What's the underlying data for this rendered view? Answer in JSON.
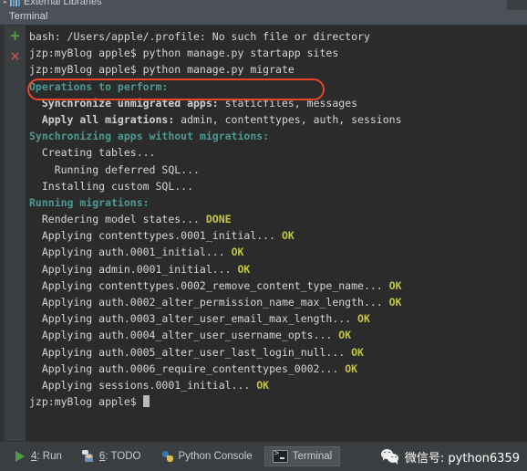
{
  "window": {
    "project_tree_row_label": "External Libraries",
    "tool_window_tab": "Terminal"
  },
  "gutter": {
    "add_icon": "+",
    "close_icon": "×"
  },
  "terminal": {
    "prompt": "jzp:myBlog apple$",
    "cursor": " ",
    "lines": [
      {
        "id": "l01",
        "segments": [
          {
            "text": "bash: /Users/apple/.profile: No such file or directory",
            "style": "default"
          }
        ]
      },
      {
        "id": "l02",
        "segments": [
          {
            "text": "jzp:myBlog apple$ python manage.py startapp sites",
            "style": "default"
          }
        ]
      },
      {
        "id": "l03",
        "segments": [
          {
            "text": "jzp:myBlog apple$ python manage.py migrate",
            "style": "default"
          }
        ],
        "highlighted": true
      },
      {
        "id": "l04",
        "segments": [
          {
            "text": "Operations to perform:",
            "style": "teal"
          }
        ]
      },
      {
        "id": "l05",
        "segments": [
          {
            "text": "  Synchronize unmigrated apps: ",
            "style": "bold"
          },
          {
            "text": "staticfiles, messages",
            "style": "default"
          }
        ]
      },
      {
        "id": "l06",
        "segments": [
          {
            "text": "  Apply all migrations: ",
            "style": "bold"
          },
          {
            "text": "admin, contenttypes, auth, sessions",
            "style": "default"
          }
        ]
      },
      {
        "id": "l07",
        "segments": [
          {
            "text": "Synchronizing apps without migrations:",
            "style": "teal"
          }
        ]
      },
      {
        "id": "l08",
        "segments": [
          {
            "text": "  Creating tables...",
            "style": "default"
          }
        ]
      },
      {
        "id": "l09",
        "segments": [
          {
            "text": "    Running deferred SQL...",
            "style": "default"
          }
        ]
      },
      {
        "id": "l10",
        "segments": [
          {
            "text": "  Installing custom SQL...",
            "style": "default"
          }
        ]
      },
      {
        "id": "l11",
        "segments": [
          {
            "text": "Running migrations:",
            "style": "teal"
          }
        ]
      },
      {
        "id": "l12",
        "segments": [
          {
            "text": "  Rendering model states... ",
            "style": "default"
          },
          {
            "text": "DONE",
            "style": "ok"
          }
        ]
      },
      {
        "id": "l13",
        "segments": [
          {
            "text": "  Applying contenttypes.0001_initial... ",
            "style": "default"
          },
          {
            "text": "OK",
            "style": "ok"
          }
        ]
      },
      {
        "id": "l14",
        "segments": [
          {
            "text": "  Applying auth.0001_initial... ",
            "style": "default"
          },
          {
            "text": "OK",
            "style": "ok"
          }
        ]
      },
      {
        "id": "l15",
        "segments": [
          {
            "text": "  Applying admin.0001_initial... ",
            "style": "default"
          },
          {
            "text": "OK",
            "style": "ok"
          }
        ]
      },
      {
        "id": "l16",
        "segments": [
          {
            "text": "  Applying contenttypes.0002_remove_content_type_name... ",
            "style": "default"
          },
          {
            "text": "OK",
            "style": "ok"
          }
        ]
      },
      {
        "id": "l17",
        "segments": [
          {
            "text": "  Applying auth.0002_alter_permission_name_max_length... ",
            "style": "default"
          },
          {
            "text": "OK",
            "style": "ok"
          }
        ]
      },
      {
        "id": "l18",
        "segments": [
          {
            "text": "  Applying auth.0003_alter_user_email_max_length... ",
            "style": "default"
          },
          {
            "text": "OK",
            "style": "ok"
          }
        ]
      },
      {
        "id": "l19",
        "segments": [
          {
            "text": "  Applying auth.0004_alter_user_username_opts... ",
            "style": "default"
          },
          {
            "text": "OK",
            "style": "ok"
          }
        ]
      },
      {
        "id": "l20",
        "segments": [
          {
            "text": "  Applying auth.0005_alter_user_last_login_null... ",
            "style": "default"
          },
          {
            "text": "OK",
            "style": "ok"
          }
        ]
      },
      {
        "id": "l21",
        "segments": [
          {
            "text": "  Applying auth.0006_require_contenttypes_0002... ",
            "style": "default"
          },
          {
            "text": "OK",
            "style": "ok"
          }
        ]
      },
      {
        "id": "l22",
        "segments": [
          {
            "text": "  Applying sessions.0001_initial... ",
            "style": "default"
          },
          {
            "text": "OK",
            "style": "ok"
          }
        ]
      },
      {
        "id": "l23",
        "segments": [
          {
            "text": "jzp:myBlog apple$ ",
            "style": "default"
          }
        ],
        "cursor": true
      }
    ]
  },
  "annotation": {
    "color": "#e8452b",
    "target_line_id": "l03",
    "shape": "rounded-rectangle"
  },
  "statusbar": {
    "items": [
      {
        "mnemonic": "4",
        "label": ": Run",
        "icon": "run-triangle-icon",
        "active": false
      },
      {
        "mnemonic": "6",
        "label": ": TODO",
        "icon": "todo-person-icon",
        "active": false
      },
      {
        "mnemonic": "",
        "label": "Python Console",
        "icon": "python-logo-icon",
        "active": false
      },
      {
        "mnemonic": "",
        "label": "Terminal",
        "icon": "terminal-prompt-icon",
        "active": true
      }
    ]
  },
  "watermark": {
    "text": "微信号: python6359",
    "logo": "wechat-logo"
  },
  "colors": {
    "terminal_bg": "#2b2b2b",
    "panel_bg": "#3c3f41",
    "header_bg": "#4b5059",
    "text": "#d6d6d6",
    "teal": "#4e9a93",
    "ok_yellow": "#c2c841",
    "annotation_red": "#e8452b",
    "add_green": "#5f9a52",
    "close_red": "#c0504d"
  }
}
